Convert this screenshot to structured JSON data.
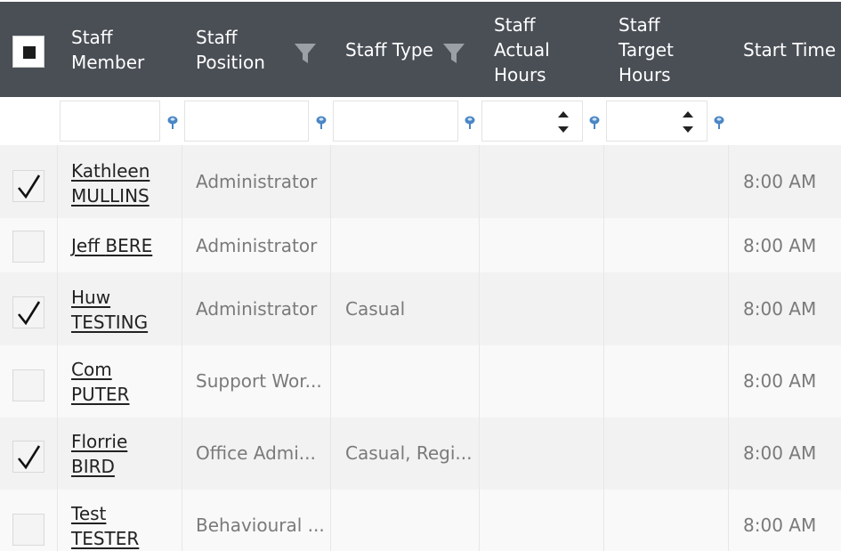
{
  "header": {
    "staff_member": "Staff\nMember",
    "staff_position": "Staff\nPosition",
    "staff_type": "Staff Type",
    "actual_hours": "Staff\nActual\nHours",
    "target_hours": "Staff\nTarget\nHours",
    "start_time": "Start Time"
  },
  "filters": {
    "staff_member": "",
    "staff_position": "",
    "staff_type": "",
    "actual_hours": "",
    "target_hours": ""
  },
  "rows": [
    {
      "first": "Kathleen",
      "last": "MULLINS",
      "position": "Administrator",
      "type": "",
      "start": "8:00 AM",
      "checked": true
    },
    {
      "first": "Jeff",
      "last": "BERE",
      "position": "Administrator",
      "type": "",
      "start": "8:00 AM",
      "checked": false
    },
    {
      "first": "Huw",
      "last": "TESTING",
      "position": "Administrator",
      "type": "Casual",
      "start": "8:00 AM",
      "checked": true
    },
    {
      "first": "Com",
      "last": "PUTER",
      "position": "Support Wor...",
      "type": "",
      "start": "8:00 AM",
      "checked": false
    },
    {
      "first": "Florrie",
      "last": "BIRD",
      "position": "Office Admi...",
      "type": "Casual, Regi...",
      "start": "8:00 AM",
      "checked": true
    },
    {
      "first": "Test",
      "last": "TESTER",
      "position": "Behavioural ...",
      "type": "",
      "start": "8:00 AM",
      "checked": false
    }
  ],
  "colors": {
    "header_bg": "#4a4f56",
    "row_odd": "#f2f2f2",
    "row_even": "#f9f9f9",
    "filter_icon": "#4a86c5"
  }
}
